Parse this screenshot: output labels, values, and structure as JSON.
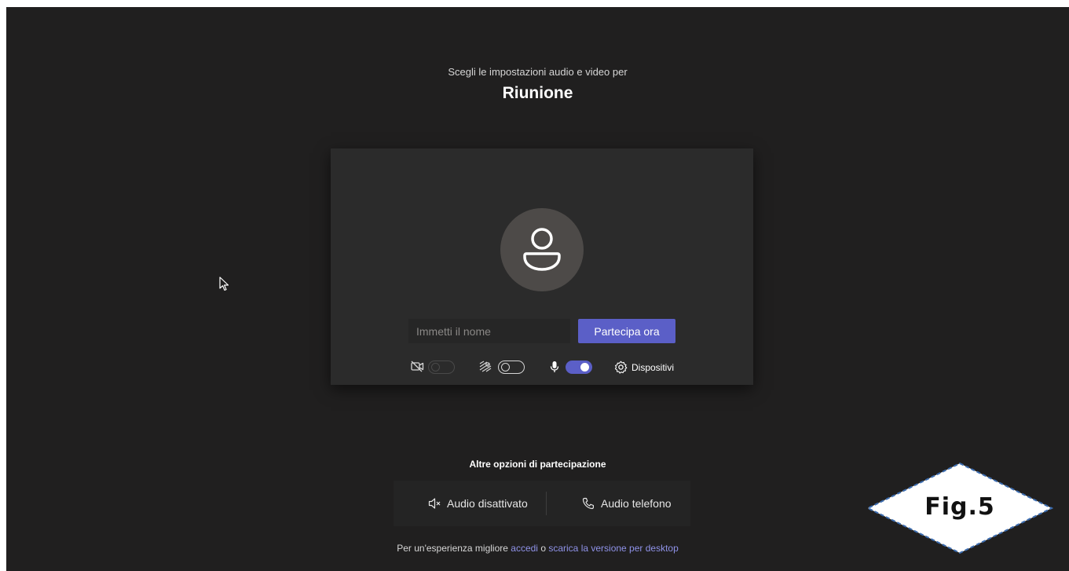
{
  "header": {
    "subtitle": "Scegli le impostazioni audio e video per",
    "meeting_title": "Riunione"
  },
  "prejoin": {
    "name_placeholder": "Immetti il nome",
    "join_label": "Partecipa ora",
    "controls": {
      "camera": {
        "icon": "camera-off-icon",
        "state": "disabled"
      },
      "background_blur": {
        "icon": "background-effects-icon",
        "state": "off"
      },
      "microphone": {
        "icon": "microphone-icon",
        "state": "on"
      },
      "devices_label": "Dispositivi",
      "devices_icon": "gear-icon"
    }
  },
  "other_options": {
    "title": "Altre opzioni di partecipazione",
    "audio_off_label": "Audio disattivato",
    "phone_audio_label": "Audio telefono"
  },
  "footer": {
    "prefix": "Per un'esperienza migliore",
    "signin_link": "accedi",
    "connector": "o",
    "download_link": "scarica la versione per desktop"
  },
  "annotation": {
    "label": "Fig.5"
  },
  "colors": {
    "background": "#201f1f",
    "panel": "#2b2b2b",
    "accent": "#5b5fc7",
    "link": "#8f92e8"
  }
}
